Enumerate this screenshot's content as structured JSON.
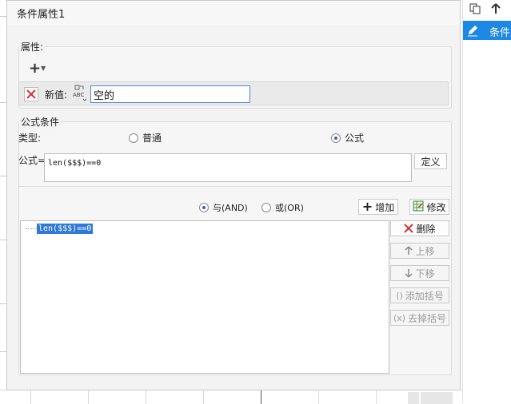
{
  "dialog": {
    "title": "条件属性1",
    "attributes_label": "属性:",
    "new_value_label": "新值:",
    "new_value": "空的",
    "formula_group_label": "公式条件",
    "type_label": "类型:",
    "type_options": [
      "普通",
      "公式"
    ],
    "type_selected": "公式",
    "formula_label": "公式=",
    "formula_text": "len($$$)==0",
    "define_button": "定义",
    "logic_options": [
      "与(AND)",
      "或(OR)"
    ],
    "logic_selected": "与(AND)",
    "add_button": "增加",
    "modify_button": "修改",
    "conditions": [
      "len($$$)==0"
    ],
    "side_buttons": {
      "delete": "删除",
      "move_up": "上移",
      "move_down": "下移",
      "add_bracket": "添加括号",
      "remove_bracket": "去掉括号"
    }
  },
  "right_panel": {
    "item_label": "条件属"
  },
  "icons": {
    "add": "plus-icon",
    "delete": "red-x-icon",
    "value_type": "abc-type-icon",
    "modify": "edit-grid-icon",
    "up": "arrow-up-icon",
    "down": "arrow-down-icon",
    "bracket": "bracket-icon",
    "remove_bracket": "remove-bracket-icon",
    "pencil": "pencil-icon",
    "copy": "copy-icon",
    "arrow_top": "arrow-up-icon"
  },
  "colors": {
    "accent": "#1e88e5",
    "selection": "#2f7ad9",
    "delete_red": "#d9302f"
  }
}
